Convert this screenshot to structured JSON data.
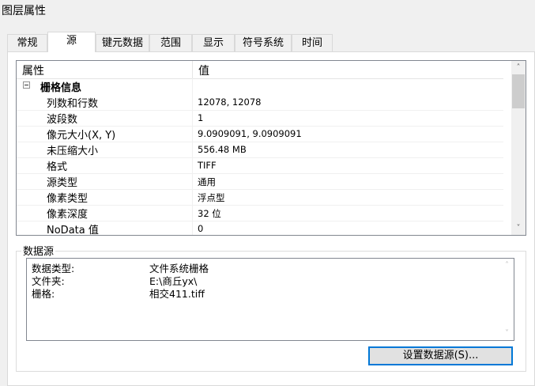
{
  "window": {
    "title": "图层属性"
  },
  "tabs": [
    {
      "label": "常规"
    },
    {
      "label": "源"
    },
    {
      "label": "键元数据"
    },
    {
      "label": "范围"
    },
    {
      "label": "显示"
    },
    {
      "label": "符号系统"
    },
    {
      "label": "时间"
    }
  ],
  "active_tab": "源",
  "property_grid": {
    "col_property": "属性",
    "col_value": "值",
    "category": "栅格信息",
    "rows": [
      {
        "name": "列数和行数",
        "value": "12078, 12078"
      },
      {
        "name": "波段数",
        "value": "1"
      },
      {
        "name": "像元大小(X, Y)",
        "value": "9.0909091, 9.0909091"
      },
      {
        "name": "未压缩大小",
        "value": "556.48 MB"
      },
      {
        "name": "格式",
        "value": "TIFF"
      },
      {
        "name": "源类型",
        "value": "通用"
      },
      {
        "name": "像素类型",
        "value": "浮点型"
      },
      {
        "name": "像素深度",
        "value": "32 位"
      },
      {
        "name": "NoData 值",
        "value": "0"
      }
    ]
  },
  "data_source": {
    "group_label": "数据源",
    "lines": [
      {
        "key": "数据类型:",
        "value": "文件系统栅格"
      },
      {
        "key": "文件夹:",
        "value": "E:\\商丘yx\\"
      },
      {
        "key": "栅格:",
        "value": "相交411.tiff"
      }
    ],
    "button_label": "设置数据源(S)..."
  }
}
